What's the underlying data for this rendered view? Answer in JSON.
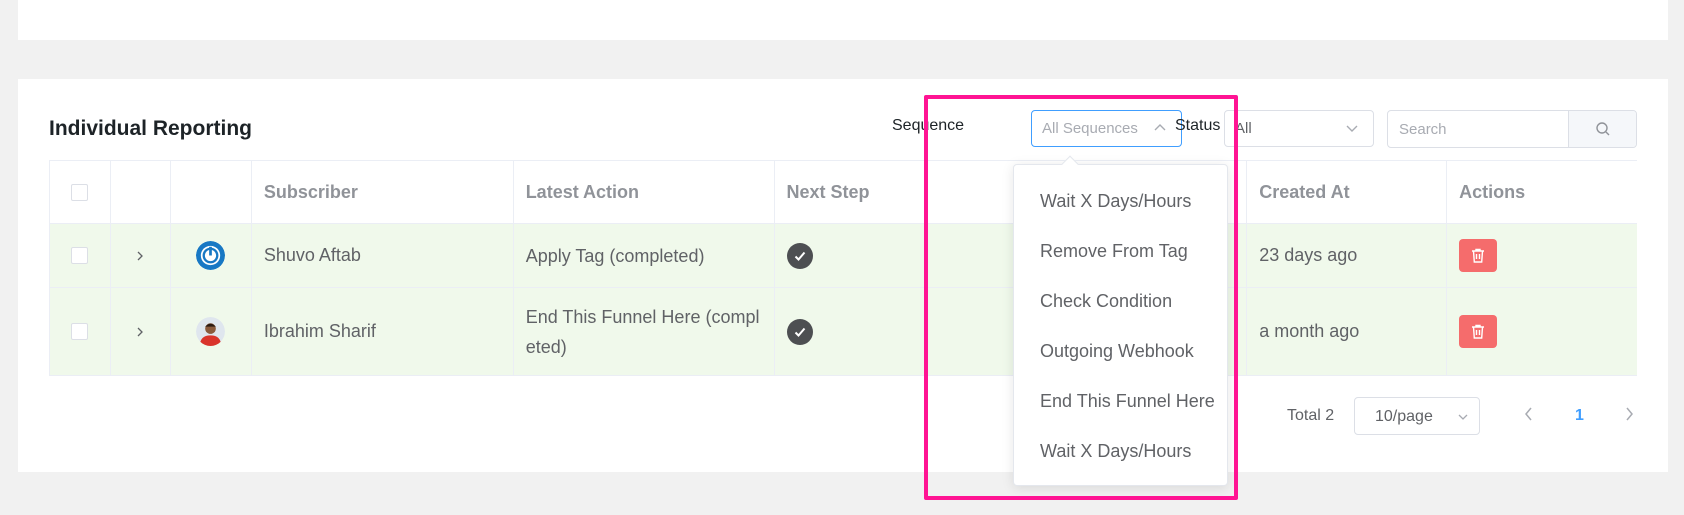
{
  "section": {
    "title": "Individual Reporting"
  },
  "filters": {
    "sequence_label": "Sequence",
    "sequence_value": "All Sequences",
    "status_label": "Status",
    "status_value": "All",
    "search_placeholder": "Search"
  },
  "table": {
    "columns": [
      "",
      "",
      "",
      "Subscriber",
      "Latest Action",
      "Next Step",
      "Created At",
      "Actions"
    ],
    "rows": [
      {
        "subscriber": "Shuvo Aftab",
        "latest_action": "Apply Tag (completed)",
        "created_at": "23 days ago"
      },
      {
        "subscriber": "Ibrahim Sharif",
        "latest_action": "End This Funnel Here (completed)",
        "created_at": "a month ago"
      }
    ]
  },
  "pagination": {
    "total": "Total 2",
    "page_size": "10/page",
    "current_page": "1"
  },
  "dropdown": {
    "items": [
      "Wait X Days/Hours",
      "Remove From Tag",
      "Check Condition",
      "Outgoing Webhook",
      "End This Funnel Here",
      "Wait X Days/Hours"
    ]
  },
  "colors": {
    "accent": "#409eff",
    "row_highlight": "#f0f9eb",
    "delete": "#f56c6c",
    "annotation": "#ff1493"
  },
  "icons": {
    "search": "search-icon",
    "expand": "chevron-right-icon",
    "next_step": "check-circle-icon",
    "delete": "trash-icon"
  }
}
